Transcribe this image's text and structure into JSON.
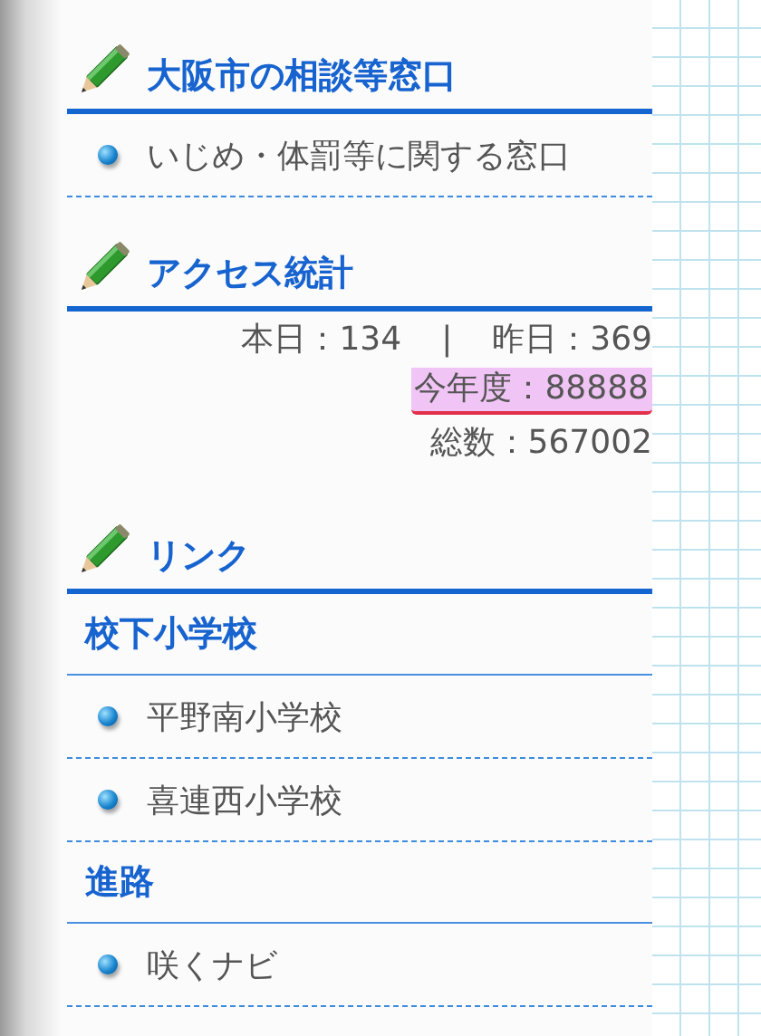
{
  "sections": [
    {
      "kind": "links",
      "title": "大阪市の相談等窓口",
      "items": [
        {
          "kind": "link",
          "text": "いじめ・体罰等に関する窓口"
        }
      ]
    },
    {
      "kind": "stats",
      "title": "アクセス統計",
      "rows": [
        {
          "items": [
            "本日：134",
            "|",
            "昨日：369"
          ],
          "highlighted": false
        },
        {
          "items": [
            "今年度：88888"
          ],
          "highlighted": true
        },
        {
          "items": [
            "総数：567002"
          ],
          "highlighted": false
        }
      ]
    },
    {
      "kind": "links",
      "title": "リンク",
      "items": [
        {
          "kind": "subheading",
          "text": "校下小学校"
        },
        {
          "kind": "link",
          "text": "平野南小学校"
        },
        {
          "kind": "link",
          "text": "喜連西小学校"
        },
        {
          "kind": "subheading",
          "text": "進路"
        },
        {
          "kind": "link",
          "text": "咲くナビ"
        }
      ]
    }
  ]
}
